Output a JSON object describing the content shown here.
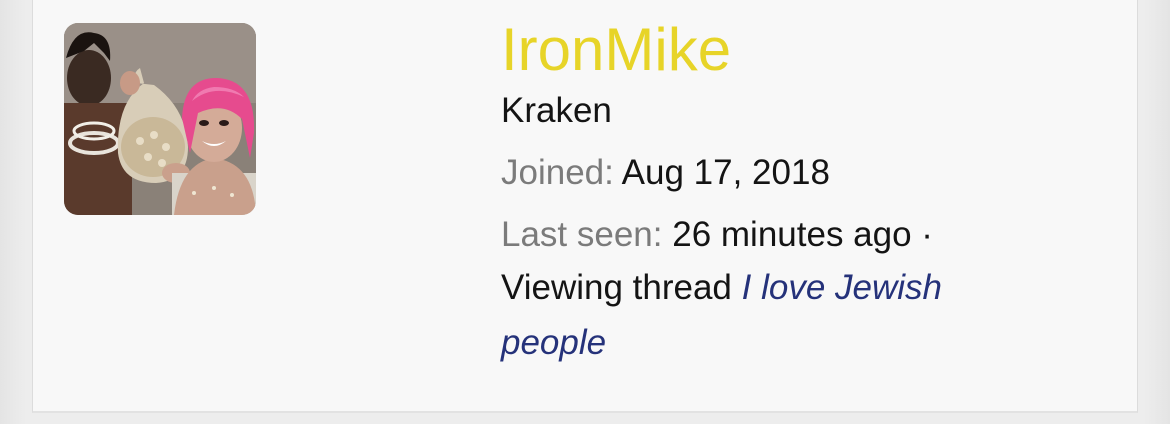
{
  "member": {
    "username": "IronMike",
    "user_title": "Kraken",
    "joined_label": "Joined:",
    "joined_value": "Aug 17, 2018",
    "last_seen_label": "Last seen:",
    "last_seen_value": "26 minutes ago",
    "separator": "·",
    "activity_prefix": "Viewing thread",
    "thread_title": "I love Jewish people"
  },
  "colors": {
    "username": "#e7d428",
    "label": "#7b7b7b",
    "text": "#141414",
    "link": "#25327a",
    "card_background": "#f8f8f8"
  }
}
